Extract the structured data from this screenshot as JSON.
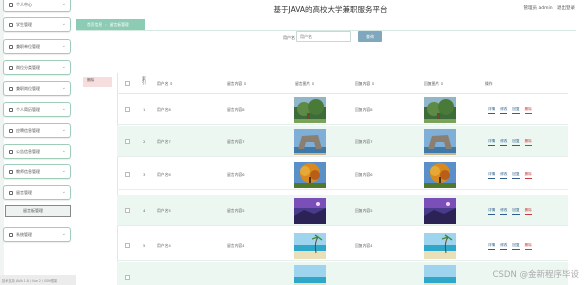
{
  "app": {
    "title": "基于JAVA的高校大学兼职服务平台"
  },
  "user": {
    "label": "管理员 admin",
    "logout_label": "退出登录"
  },
  "breadcrumb": {
    "home": "首页信息",
    "current": "留言板管理"
  },
  "sidebar": {
    "items": [
      {
        "label": "个人中心"
      },
      {
        "label": "学生管理"
      },
      {
        "label": "兼职单位管理"
      },
      {
        "label": "岗位分类管理"
      },
      {
        "label": "兼职岗位管理"
      },
      {
        "label": "个人简历管理"
      },
      {
        "label": "应聘信息管理"
      },
      {
        "label": "公告信息管理"
      },
      {
        "label": "教师信息管理"
      },
      {
        "label": "留言管理"
      },
      {
        "label": "留言板管理"
      },
      {
        "label": "系统管理"
      }
    ]
  },
  "search": {
    "label": "用户名",
    "placeholder": "用户名",
    "button_label": "查询"
  },
  "actions": {
    "add_label": "删除"
  },
  "table": {
    "headers": [
      "索引",
      "用户名",
      "留言内容",
      "留言图片",
      "回复内容",
      "回复图片",
      "操作"
    ],
    "sort_mark": "⇕",
    "rows": [
      {
        "index": "1",
        "username": "用户名8",
        "message": "留言内容8",
        "reply": "回复内容8",
        "image": "forest"
      },
      {
        "index": "2",
        "username": "用户名7",
        "message": "留言内容7",
        "reply": "回复内容7",
        "image": "arch"
      },
      {
        "index": "3",
        "username": "用户名6",
        "message": "留言内容6",
        "reply": "回复内容6",
        "image": "autumn"
      },
      {
        "index": "4",
        "username": "用户名5",
        "message": "留言内容5",
        "reply": "回复内容5",
        "image": "purple"
      },
      {
        "index": "5",
        "username": "用户名4",
        "message": "留言内容4",
        "reply": "回复内容4",
        "image": "beach"
      }
    ],
    "ops": {
      "detail": "详情",
      "edit": "修改",
      "reply": "回复",
      "delete": "删除"
    }
  },
  "status_bar": {
    "text": "技术支持 JAVA 1.8 / Vue 2 / SSM框架"
  },
  "watermark": "CSDN @金新程序毕设"
}
